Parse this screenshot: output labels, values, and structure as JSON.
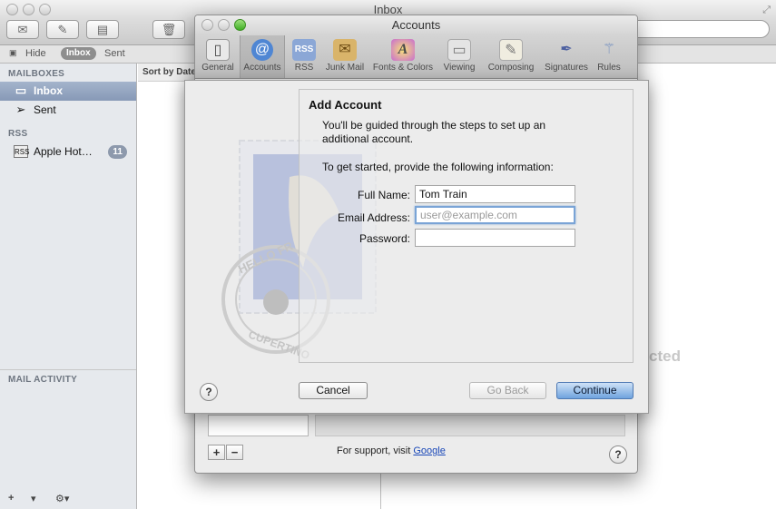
{
  "mail_window": {
    "title": "Inbox",
    "toolbar": {
      "get_mail_icon": "envelope-icon",
      "compose_icon": "compose-icon",
      "note_icon": "note-icon",
      "delete_icon": "trash-icon"
    },
    "favorites": {
      "hide_label": "Hide",
      "inbox_label": "Inbox",
      "sent_label": "Sent"
    },
    "sidebar": {
      "mailboxes_header": "MAILBOXES",
      "items": [
        {
          "label": "Inbox",
          "icon": "inbox-icon"
        },
        {
          "label": "Sent",
          "icon": "paper-plane-icon"
        }
      ],
      "rss_header": "RSS",
      "rss_items": [
        {
          "label": "Apple Hot…",
          "badge": "11",
          "icon": "rss-icon"
        }
      ],
      "activity_header": "MAIL ACTIVITY"
    },
    "list_header": "Sort by Date",
    "background_text": "cted"
  },
  "prefs_window": {
    "title": "Accounts",
    "tabs": [
      {
        "label": "General",
        "icon": "switch-icon"
      },
      {
        "label": "Accounts",
        "icon": "at-sign-icon"
      },
      {
        "label": "RSS",
        "icon": "rss-icon"
      },
      {
        "label": "Junk Mail",
        "icon": "junk-mail-icon"
      },
      {
        "label": "Fonts & Colors",
        "icon": "fonts-colors-icon"
      },
      {
        "label": "Viewing",
        "icon": "viewing-icon"
      },
      {
        "label": "Composing",
        "icon": "composing-icon"
      },
      {
        "label": "Signatures",
        "icon": "signature-icon"
      },
      {
        "label": "Rules",
        "icon": "rules-icon"
      }
    ],
    "support_text": "For support, visit",
    "support_link": "Google",
    "add_label": "+",
    "remove_label": "−",
    "help_label": "?"
  },
  "sheet": {
    "title": "Add Account",
    "intro": "You'll be guided through the steps to set up an additional account.",
    "instruction": "To get started, provide the following information:",
    "full_name_label": "Full Name:",
    "full_name_value": "Tom Train",
    "email_label": "Email Address:",
    "email_placeholder": "user@example.com",
    "password_label": "Password:",
    "password_value": "",
    "help_label": "?",
    "cancel_label": "Cancel",
    "go_back_label": "Go Back",
    "continue_label": "Continue",
    "stamp_text_top": "HELLO FR",
    "stamp_text_bottom": "CUPERTINO"
  }
}
